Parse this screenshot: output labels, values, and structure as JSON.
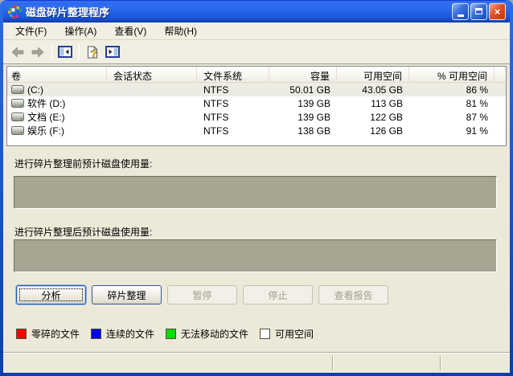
{
  "window": {
    "title": "磁盘碎片整理程序",
    "controls": {
      "minimize": "最小化",
      "maximize": "最大化",
      "close": "关闭"
    }
  },
  "menu_bar": {
    "items": [
      {
        "label": "文件(F)"
      },
      {
        "label": "操作(A)"
      },
      {
        "label": "查看(V)"
      },
      {
        "label": "帮助(H)"
      }
    ]
  },
  "toolbar": {
    "icons": [
      {
        "name": "back-arrow",
        "enabled": false
      },
      {
        "name": "forward-arrow",
        "enabled": false
      },
      {
        "name": "show-console-tree",
        "enabled": true
      },
      {
        "name": "help-document",
        "enabled": true
      },
      {
        "name": "show-action-pane",
        "enabled": true
      }
    ]
  },
  "volume_table": {
    "columns": [
      {
        "label": "卷",
        "align": "left"
      },
      {
        "label": "会话状态",
        "align": "left"
      },
      {
        "label": "文件系统",
        "align": "left"
      },
      {
        "label": "容量",
        "align": "right"
      },
      {
        "label": "可用空间",
        "align": "right"
      },
      {
        "label": "% 可用空间",
        "align": "right"
      }
    ],
    "rows": [
      {
        "volume": "(C:)",
        "session_status": "",
        "file_system": "NTFS",
        "capacity": "50.01 GB",
        "free_space": "43.05 GB",
        "percent_free": "86 %",
        "selected": true
      },
      {
        "volume": "软件 (D:)",
        "session_status": "",
        "file_system": "NTFS",
        "capacity": "139 GB",
        "free_space": "113 GB",
        "percent_free": "81 %",
        "selected": false
      },
      {
        "volume": "文档 (E:)",
        "session_status": "",
        "file_system": "NTFS",
        "capacity": "139 GB",
        "free_space": "122 GB",
        "percent_free": "87 %",
        "selected": false
      },
      {
        "volume": "娱乐 (F:)",
        "session_status": "",
        "file_system": "NTFS",
        "capacity": "138 GB",
        "free_space": "126 GB",
        "percent_free": "91 %",
        "selected": false
      }
    ]
  },
  "usage_panels": {
    "before_label": "进行碎片整理前预计磁盘使用量:",
    "after_label": "进行碎片整理后预计磁盘使用量:",
    "bar_fill_color": "#A8A693"
  },
  "action_buttons": [
    {
      "label": "分析",
      "enabled": true,
      "focused": true
    },
    {
      "label": "碎片整理",
      "enabled": true,
      "focused": false
    },
    {
      "label": "暂停",
      "enabled": false,
      "focused": false
    },
    {
      "label": "停止",
      "enabled": false,
      "focused": false
    },
    {
      "label": "查看报告",
      "enabled": false,
      "focused": false
    }
  ],
  "legend": {
    "items": [
      {
        "label": "零碎的文件",
        "color": "#FF0000"
      },
      {
        "label": "连续的文件",
        "color": "#0000EE"
      },
      {
        "label": "无法移动的文件",
        "color": "#00DD00"
      },
      {
        "label": "可用空间",
        "color": "#FFFFFF"
      }
    ]
  },
  "status_bar": {
    "text": ""
  },
  "colors": {
    "titlebar_blue": "#2565E8",
    "window_border": "#0A5BD7",
    "selected_row": "#EDECE2"
  }
}
